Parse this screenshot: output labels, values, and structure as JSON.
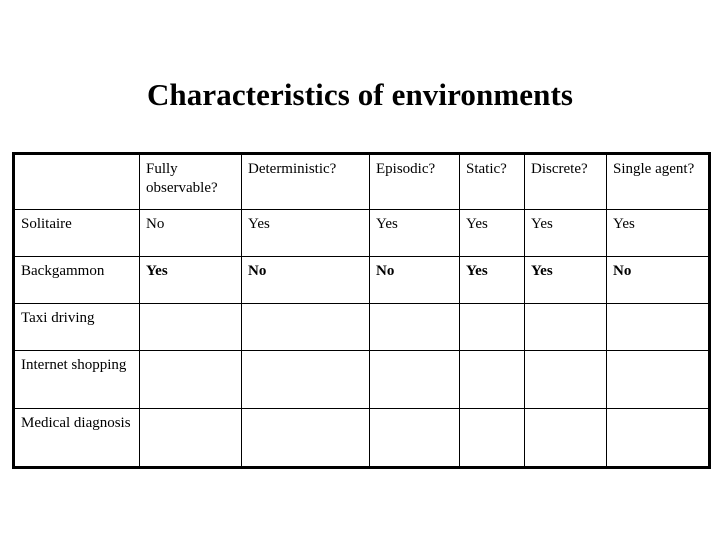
{
  "slide": {
    "title": "Characteristics of environments",
    "accent_color": "#333399",
    "text_color": "#000000",
    "background_color": "#ffffff"
  },
  "table": {
    "corner_header": "",
    "columns": [
      "Fully observable?",
      "Deterministic?",
      "Episodic?",
      "Static?",
      "Discrete?",
      "Single agent?"
    ],
    "rows": [
      {
        "label": "Solitaire",
        "style": "plain",
        "values": [
          "No",
          "Yes",
          "Yes",
          "Yes",
          "Yes",
          "Yes"
        ]
      },
      {
        "label": "Backgammon",
        "style": "accent",
        "values": [
          "Yes",
          "No",
          "No",
          "Yes",
          "Yes",
          "No"
        ]
      },
      {
        "label": "Taxi driving",
        "style": "plain",
        "values": [
          "",
          "",
          "",
          "",
          "",
          ""
        ]
      },
      {
        "label": "Internet shopping",
        "style": "plain",
        "values": [
          "",
          "",
          "",
          "",
          "",
          ""
        ]
      },
      {
        "label": "Medical diagnosis",
        "style": "plain",
        "values": [
          "",
          "",
          "",
          "",
          "",
          ""
        ]
      }
    ]
  }
}
